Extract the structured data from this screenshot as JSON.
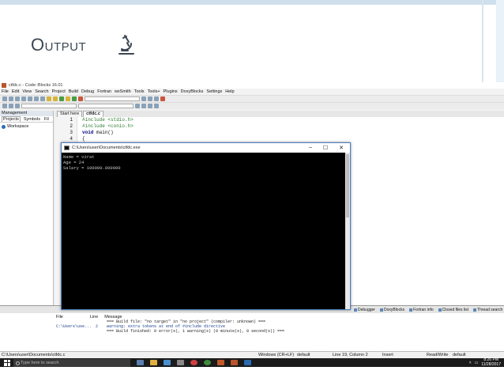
{
  "slide": {
    "title": "Output"
  },
  "codeblocks": {
    "window_title": "ctfdc.c - Code::Blocks 16.01",
    "menu": [
      "File",
      "Edit",
      "View",
      "Search",
      "Project",
      "Build",
      "Debug",
      "Fortran",
      "wxSmith",
      "Tools",
      "Tools+",
      "Plugins",
      "DoxyBlocks",
      "Settings",
      "Help"
    ],
    "management": {
      "header": "Management",
      "tabs": [
        "Projects",
        "Symbols",
        "Fil"
      ],
      "workspace": "Workspace"
    },
    "editor_tabs": [
      "Start here",
      "ctfdc.c"
    ],
    "line_numbers": [
      "1",
      "2",
      "3",
      "4",
      "5"
    ],
    "code": {
      "l1": "#include <stdio.h>",
      "l2": "#include <conio.h>",
      "l3_kw": "void",
      "l3_rest": " main()",
      "l4": "{"
    }
  },
  "console": {
    "title": "C:\\Users\\user\\Documents\\ctfdc.exe",
    "lines": [
      "Name = virat",
      "Age = 24",
      "Salary = 100000.000000"
    ],
    "controls": {
      "min": "–",
      "max": "☐",
      "close": "✕"
    }
  },
  "logs": {
    "tabs": [
      "Code::Blocks",
      "Search results",
      "Cccc",
      "Build log",
      "Build messages",
      "CppCheck",
      "CppCheck messages",
      "Cscope",
      "Debugger",
      "DoxyBlocks",
      "Fortran info",
      "Closed files list",
      "Thread search"
    ],
    "headers": {
      "file": "File",
      "line": "Line",
      "message": "Message"
    },
    "rows": [
      {
        "file": "",
        "line": "",
        "message": "=== Build file: \"no target\" in \"no project\" (compiler: unknown) ==="
      },
      {
        "file": "C:\\Users\\use...",
        "line": "2",
        "message": "warning: extra tokens at end of #include directive"
      },
      {
        "file": "",
        "line": "",
        "message": "=== Build finished: 0 error(s), 1 warning(s) (0 minute(s), 0 second(s)) ==="
      }
    ]
  },
  "status": {
    "path": "C:\\Users\\user\\Documents\\ctfdc.c",
    "eol": "Windows (CR+LF)",
    "encoding": "default",
    "position": "Line 19, Column 2",
    "mode": "Insert",
    "access": "Read/Write",
    "lang": "default"
  },
  "taskbar": {
    "search_placeholder": "Type here to search",
    "time": "8:26 PM",
    "date": "11/28/2017"
  }
}
